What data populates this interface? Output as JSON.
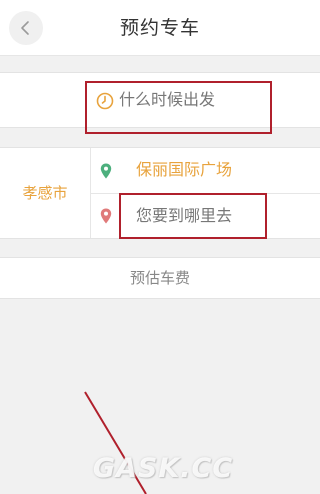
{
  "header": {
    "title": "预约专车",
    "back_icon": "chevron-left-icon"
  },
  "time_selector": {
    "placeholder": "什么时候出发",
    "icon": "clock-icon",
    "icon_color": "#e8a33d"
  },
  "route": {
    "city": "孝感市",
    "start": {
      "label": "保丽国际广场",
      "icon": "start-pin-icon",
      "icon_color": "#4caf7d"
    },
    "destination": {
      "placeholder": "您要到哪里去",
      "icon": "destination-pin-icon",
      "icon_color": "#e07a7a"
    }
  },
  "fare": {
    "label": "预估车费"
  },
  "annotation": {
    "highlight_color": "#b0202c"
  },
  "watermark": {
    "text": "GASK.CC"
  },
  "colors": {
    "accent": "#e8a33d",
    "background": "#f1f1f1"
  }
}
